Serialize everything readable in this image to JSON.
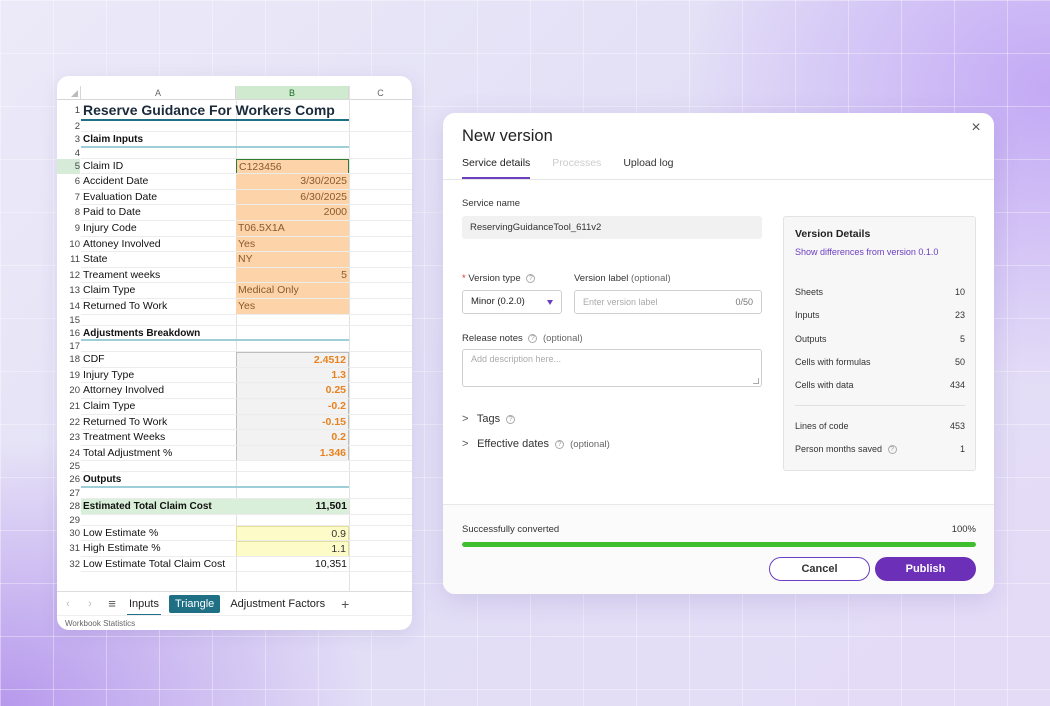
{
  "spreadsheet": {
    "columns": [
      "A",
      "B",
      "C"
    ],
    "rows": [
      {
        "n": "1",
        "a": "Reserve Guidance For Workers Comp",
        "b": "",
        "style": "title"
      },
      {
        "n": "2",
        "a": "",
        "b": "",
        "style": "blank"
      },
      {
        "n": "3",
        "a": "Claim Inputs",
        "b": "",
        "style": "section"
      },
      {
        "n": "4",
        "a": "",
        "b": "",
        "style": "blank"
      },
      {
        "n": "5",
        "a": "Claim ID",
        "b": "C123456",
        "style": "input-left-selected"
      },
      {
        "n": "6",
        "a": "Accident Date",
        "b": "3/30/2025",
        "style": "input-right"
      },
      {
        "n": "7",
        "a": "Evaluation Date",
        "b": "6/30/2025",
        "style": "input-right"
      },
      {
        "n": "8",
        "a": "Paid to Date",
        "b": "2000",
        "style": "input-right"
      },
      {
        "n": "9",
        "a": "Injury Code",
        "b": "T06.5X1A",
        "style": "input-left"
      },
      {
        "n": "10",
        "a": "Attoney Involved",
        "b": "Yes",
        "style": "input-left"
      },
      {
        "n": "11",
        "a": "State",
        "b": "NY",
        "style": "input-left"
      },
      {
        "n": "12",
        "a": "Treament weeks",
        "b": "5",
        "style": "input-right"
      },
      {
        "n": "13",
        "a": "Claim Type",
        "b": "Medical Only",
        "style": "input-left"
      },
      {
        "n": "14",
        "a": "Returned To Work",
        "b": "Yes",
        "style": "input-left"
      },
      {
        "n": "15",
        "a": "",
        "b": "",
        "style": "blank"
      },
      {
        "n": "16",
        "a": "Adjustments Breakdown",
        "b": "",
        "style": "section"
      },
      {
        "n": "17",
        "a": "",
        "b": "",
        "style": "blank"
      },
      {
        "n": "18",
        "a": "CDF",
        "b": "2.4512",
        "style": "calc"
      },
      {
        "n": "19",
        "a": "Injury Type",
        "b": "1.3",
        "style": "calc"
      },
      {
        "n": "20",
        "a": "Attorney Involved",
        "b": "0.25",
        "style": "calc"
      },
      {
        "n": "21",
        "a": "Claim Type",
        "b": "-0.2",
        "style": "calc"
      },
      {
        "n": "22",
        "a": "Returned To Work",
        "b": "-0.15",
        "style": "calc"
      },
      {
        "n": "23",
        "a": "Treatment Weeks",
        "b": "0.2",
        "style": "calc"
      },
      {
        "n": "24",
        "a": "Total Adjustment %",
        "b": "1.346",
        "style": "calc"
      },
      {
        "n": "25",
        "a": "",
        "b": "",
        "style": "blank"
      },
      {
        "n": "26",
        "a": "Outputs",
        "b": "",
        "style": "section"
      },
      {
        "n": "27",
        "a": "",
        "b": "",
        "style": "blank"
      },
      {
        "n": "28",
        "a": "Estimated Total Claim Cost",
        "b": "11,501",
        "style": "output"
      },
      {
        "n": "29",
        "a": "",
        "b": "",
        "style": "blank"
      },
      {
        "n": "30",
        "a": "Low Estimate %",
        "b": "0.9",
        "style": "yellow"
      },
      {
        "n": "31",
        "a": "High Estimate %",
        "b": "1.1",
        "style": "yellow"
      },
      {
        "n": "32",
        "a": "Low Estimate Total Claim Cost",
        "b": "10,351",
        "style": "plain-right"
      }
    ],
    "tabs": [
      {
        "label": "Inputs",
        "state": "underline"
      },
      {
        "label": "Triangle",
        "state": "active"
      },
      {
        "label": "Adjustment Factors",
        "state": "normal"
      }
    ],
    "nav_prev": "‹",
    "nav_next": "›",
    "menu_icon": "≡",
    "add_icon": "+",
    "status_text": "Workbook Statistics"
  },
  "dialog": {
    "title": "New version",
    "close_icon": "×",
    "tabs": [
      "Service details",
      "Processes",
      "Upload log"
    ],
    "service_name_label": "Service name",
    "service_name_value": "ReservingGuidanceTool_611v2",
    "version_type_label": "Version type",
    "version_type_value": "Minor (0.2.0)",
    "version_label_label": "Version label",
    "version_label_optional": "(optional)",
    "version_label_placeholder": "Enter version label",
    "version_label_count": "0/50",
    "release_notes_label": "Release notes",
    "release_notes_optional": "(optional)",
    "release_notes_placeholder": "Add description here...",
    "tags_label": "Tags",
    "effective_dates_label": "Effective dates",
    "effective_dates_optional": "(optional)",
    "required_mark": "*",
    "help_glyph": "?",
    "chevron_glyph": ">",
    "version_details": {
      "title": "Version Details",
      "link": "Show differences from version 0.1.0",
      "stats": [
        {
          "label": "Sheets",
          "value": "10"
        },
        {
          "label": "Inputs",
          "value": "23"
        },
        {
          "label": "Outputs",
          "value": "5"
        },
        {
          "label": "Cells with formulas",
          "value": "50"
        },
        {
          "label": "Cells with data",
          "value": "434"
        }
      ],
      "extra_stats": [
        {
          "label": "Lines of code",
          "value": "453"
        },
        {
          "label": "Person months saved",
          "value": "1"
        }
      ]
    },
    "progress_label": "Successfully converted",
    "progress_text": "100%",
    "progress_value": 100,
    "cancel_label": "Cancel",
    "publish_label": "Publish"
  },
  "colors": {
    "accent": "#6b2fb8",
    "progress": "#3fbf2e",
    "input_fill": "#fdd3a9",
    "calc_text": "#e8821f",
    "output_fill": "#d9efd9",
    "yellow_fill": "#fdfbc8",
    "sheet_tab_active": "#1f6f85"
  }
}
